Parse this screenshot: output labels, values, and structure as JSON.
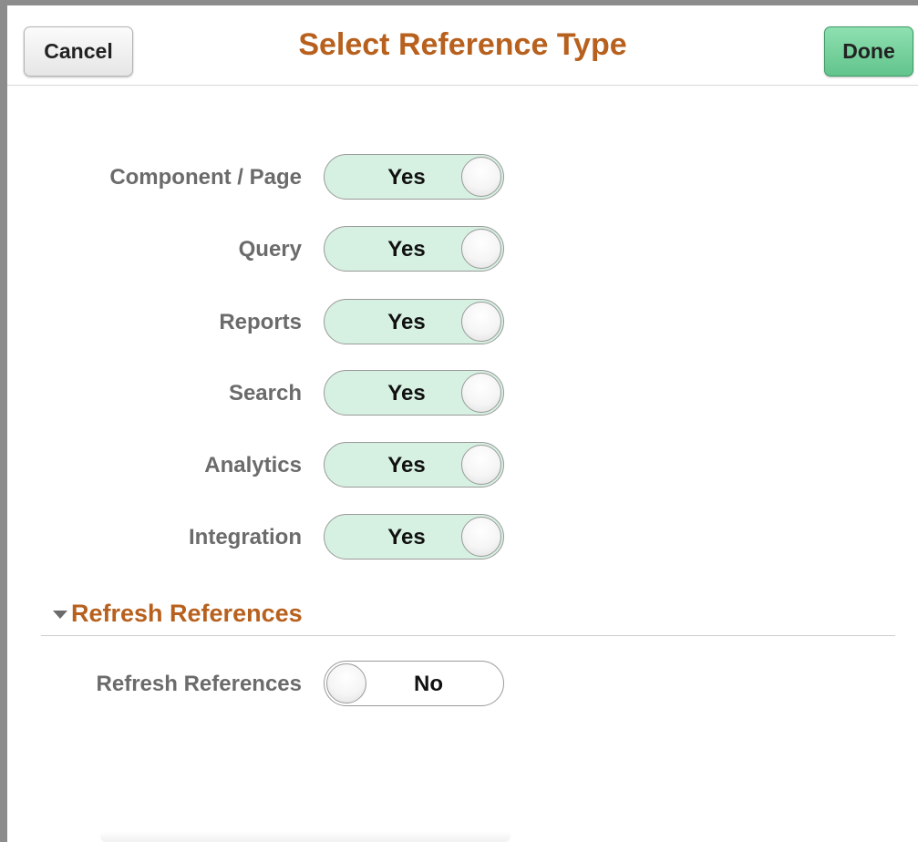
{
  "header": {
    "title": "Select Reference Type",
    "cancel_label": "Cancel",
    "done_label": "Done"
  },
  "toggles": [
    {
      "label": "Component / Page",
      "value": "Yes",
      "state": "on"
    },
    {
      "label": "Query",
      "value": "Yes",
      "state": "on"
    },
    {
      "label": "Reports",
      "value": "Yes",
      "state": "on"
    },
    {
      "label": "Search",
      "value": "Yes",
      "state": "on"
    },
    {
      "label": "Analytics",
      "value": "Yes",
      "state": "on"
    },
    {
      "label": "Integration",
      "value": "Yes",
      "state": "on"
    }
  ],
  "refresh_section": {
    "title": "Refresh References",
    "expanded": true,
    "toggle": {
      "label": "Refresh References",
      "value": "No",
      "state": "off"
    }
  },
  "colors": {
    "accent_title": "#b8601d",
    "toggle_on_bg": "#d6f1e2",
    "done_button": "#62c48c"
  },
  "icons": {
    "section_toggle": "triangle-down-icon"
  }
}
